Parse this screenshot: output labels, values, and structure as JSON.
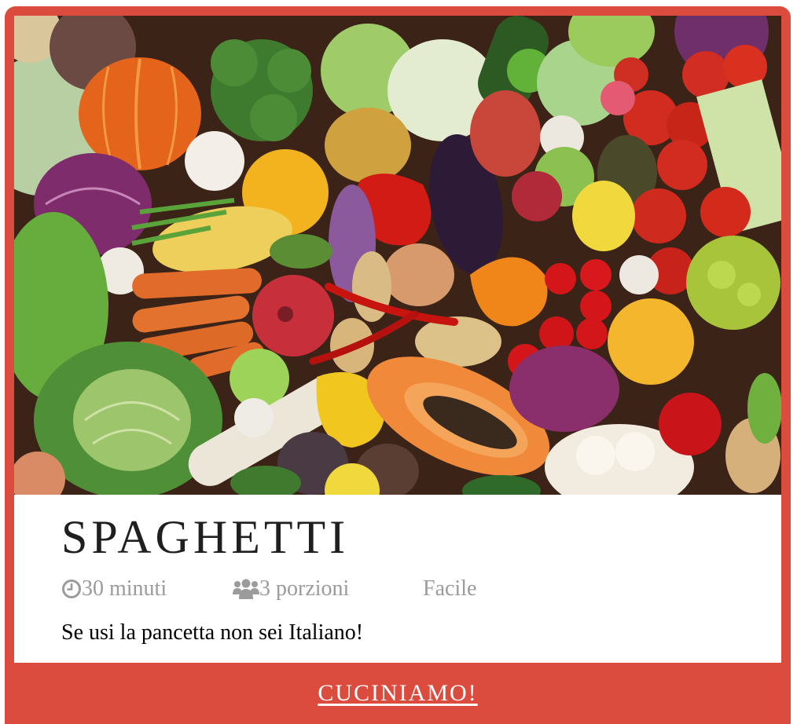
{
  "recipe": {
    "title": "SPAGHETTI",
    "time": "30 minuti",
    "servings": "3 porzioni",
    "difficulty": "Facile",
    "description": "Se usi la pancetta non sei Italiano!",
    "cta_label": "CUCINIAMO!",
    "time_icon": "clock-icon",
    "servings_icon": "people-icon",
    "image_icon": "vegetables-photo"
  },
  "colors": {
    "accent": "#db4c3f",
    "meta_text": "#9b9b9b",
    "title_text": "#1f1f1f",
    "body_bg": "#ffffff"
  }
}
